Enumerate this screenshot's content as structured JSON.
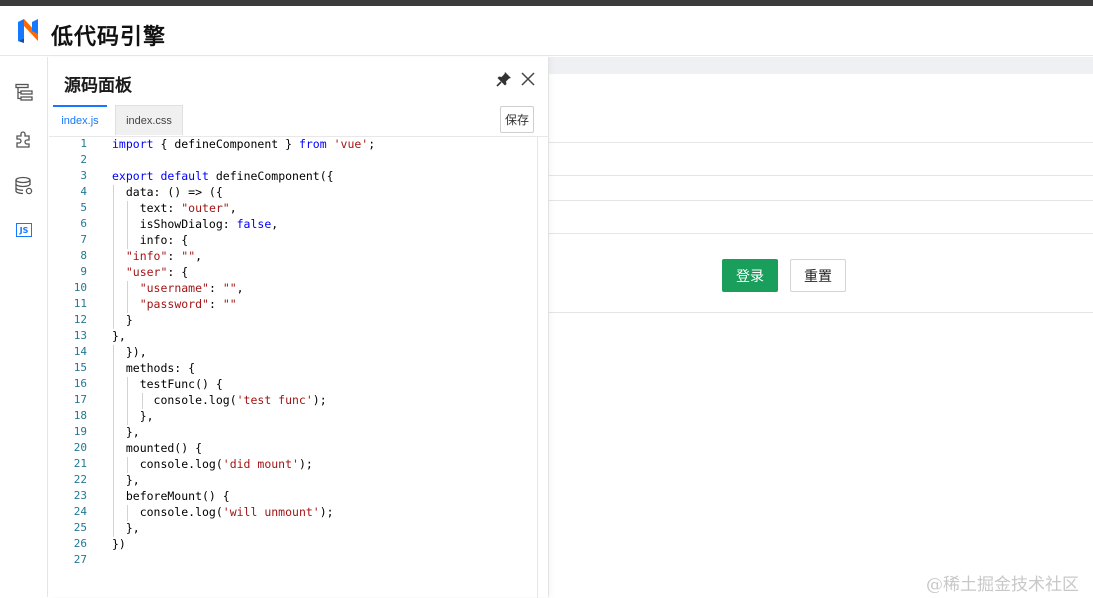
{
  "header": {
    "brand": "低代码引擎",
    "logo_icon": "lowcode-engine-logo"
  },
  "leftbar": {
    "items": [
      {
        "name": "outline",
        "icon": "outline-tree-icon"
      },
      {
        "name": "components",
        "icon": "puzzle-icon"
      },
      {
        "name": "datasource",
        "icon": "database-icon"
      },
      {
        "name": "source-code",
        "icon": "js-icon",
        "label": "JS",
        "active": true
      }
    ]
  },
  "panel": {
    "title": "源码面板",
    "tabs": [
      {
        "label": "index.js",
        "active": true
      },
      {
        "label": "index.css",
        "active": false
      }
    ],
    "save_label": "保存",
    "code_lines": [
      {
        "n": "1",
        "tokens": [
          [
            "kw",
            "import"
          ],
          [
            "t",
            " { defineComponent } "
          ],
          [
            "kw",
            "from"
          ],
          [
            "t",
            " "
          ],
          [
            "str",
            "'vue'"
          ],
          [
            "t",
            ";"
          ]
        ]
      },
      {
        "n": "2",
        "tokens": []
      },
      {
        "n": "3",
        "tokens": [
          [
            "kw",
            "export"
          ],
          [
            "t",
            " "
          ],
          [
            "kw",
            "default"
          ],
          [
            "t",
            " defineComponent({"
          ]
        ]
      },
      {
        "n": "4",
        "tokens": [
          [
            "t",
            "  data: () => ({"
          ]
        ]
      },
      {
        "n": "5",
        "tokens": [
          [
            "t",
            "    text: "
          ],
          [
            "str",
            "\"outer\""
          ],
          [
            "t",
            ","
          ]
        ]
      },
      {
        "n": "6",
        "tokens": [
          [
            "t",
            "    isShowDialog: "
          ],
          [
            "kw",
            "false"
          ],
          [
            "t",
            ","
          ]
        ]
      },
      {
        "n": "7",
        "tokens": [
          [
            "t",
            "    info: {"
          ]
        ]
      },
      {
        "n": "8",
        "tokens": [
          [
            "t",
            "  "
          ],
          [
            "str",
            "\"info\""
          ],
          [
            "t",
            ": "
          ],
          [
            "str",
            "\"\""
          ],
          [
            "t",
            ","
          ]
        ]
      },
      {
        "n": "9",
        "tokens": [
          [
            "t",
            "  "
          ],
          [
            "str",
            "\"user\""
          ],
          [
            "t",
            ": {"
          ]
        ]
      },
      {
        "n": "10",
        "tokens": [
          [
            "t",
            "    "
          ],
          [
            "str",
            "\"username\""
          ],
          [
            "t",
            ": "
          ],
          [
            "str",
            "\"\""
          ],
          [
            "t",
            ","
          ]
        ]
      },
      {
        "n": "11",
        "tokens": [
          [
            "t",
            "    "
          ],
          [
            "str",
            "\"password\""
          ],
          [
            "t",
            ": "
          ],
          [
            "str",
            "\"\""
          ]
        ]
      },
      {
        "n": "12",
        "tokens": [
          [
            "t",
            "  }"
          ]
        ]
      },
      {
        "n": "13",
        "tokens": [
          [
            "t",
            "},"
          ]
        ]
      },
      {
        "n": "14",
        "tokens": [
          [
            "t",
            "  }),"
          ]
        ]
      },
      {
        "n": "15",
        "tokens": [
          [
            "t",
            "  methods: {"
          ]
        ]
      },
      {
        "n": "16",
        "tokens": [
          [
            "t",
            "    testFunc() {"
          ]
        ]
      },
      {
        "n": "17",
        "tokens": [
          [
            "t",
            "      console.log("
          ],
          [
            "str",
            "'test func'"
          ],
          [
            "t",
            ");"
          ]
        ]
      },
      {
        "n": "18",
        "tokens": [
          [
            "t",
            "    },"
          ]
        ]
      },
      {
        "n": "19",
        "tokens": [
          [
            "t",
            "  },"
          ]
        ]
      },
      {
        "n": "20",
        "tokens": [
          [
            "t",
            "  mounted() {"
          ]
        ]
      },
      {
        "n": "21",
        "tokens": [
          [
            "t",
            "    console.log("
          ],
          [
            "str",
            "'did mount'"
          ],
          [
            "t",
            ");"
          ]
        ]
      },
      {
        "n": "22",
        "tokens": [
          [
            "t",
            "  },"
          ]
        ]
      },
      {
        "n": "23",
        "tokens": [
          [
            "t",
            "  beforeMount() {"
          ]
        ]
      },
      {
        "n": "24",
        "tokens": [
          [
            "t",
            "    console.log("
          ],
          [
            "str",
            "'will unmount'"
          ],
          [
            "t",
            ");"
          ]
        ]
      },
      {
        "n": "25",
        "tokens": [
          [
            "t",
            "  },"
          ]
        ]
      },
      {
        "n": "26",
        "tokens": [
          [
            "t",
            "})"
          ]
        ]
      },
      {
        "n": "27",
        "tokens": []
      }
    ]
  },
  "canvas": {
    "login_label": "登录",
    "reset_label": "重置"
  },
  "watermark": "@稀土掘金技术社区",
  "colors": {
    "accent": "#1677ff",
    "login_button": "#1a9e5c",
    "keyword": "#0000ff",
    "string": "#a31515",
    "line_number": "#237893"
  }
}
